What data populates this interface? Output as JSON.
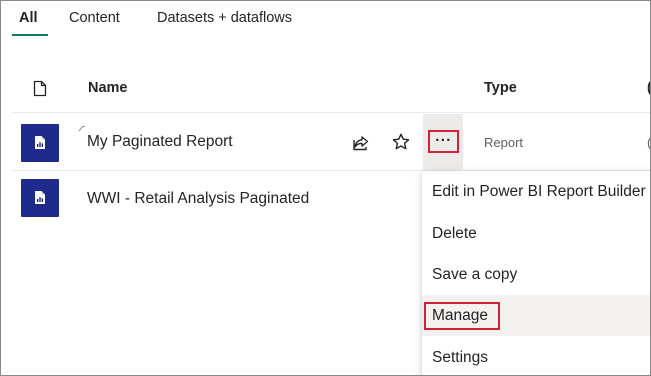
{
  "tabs": [
    {
      "label": "All",
      "active": true
    },
    {
      "label": "Content",
      "active": false
    },
    {
      "label": "Datasets + dataflows",
      "active": false
    }
  ],
  "columns": {
    "icon": "document-icon",
    "name": "Name",
    "type": "Type",
    "next_cut": "("
  },
  "rows": [
    {
      "icon": "paginated-report-icon",
      "name": "My Paginated Report",
      "type": "Report",
      "next_cut": "("
    },
    {
      "icon": "paginated-report-icon",
      "name": "WWI - Retail Analysis Paginated"
    }
  ],
  "row_actions": {
    "share_icon": "share-icon",
    "favorite_icon": "star-icon",
    "more_label": "···"
  },
  "context_menu": {
    "items": [
      {
        "label": "Edit in Power BI Report Builder"
      },
      {
        "label": "Delete"
      },
      {
        "label": "Save a copy"
      },
      {
        "label": "Manage",
        "highlighted": true
      },
      {
        "label": "Settings"
      }
    ]
  },
  "colors": {
    "accent_underline": "#117865",
    "report_tile": "#1e2a8c",
    "highlight_box": "#d1223a",
    "hover_bg": "#edebe9"
  }
}
